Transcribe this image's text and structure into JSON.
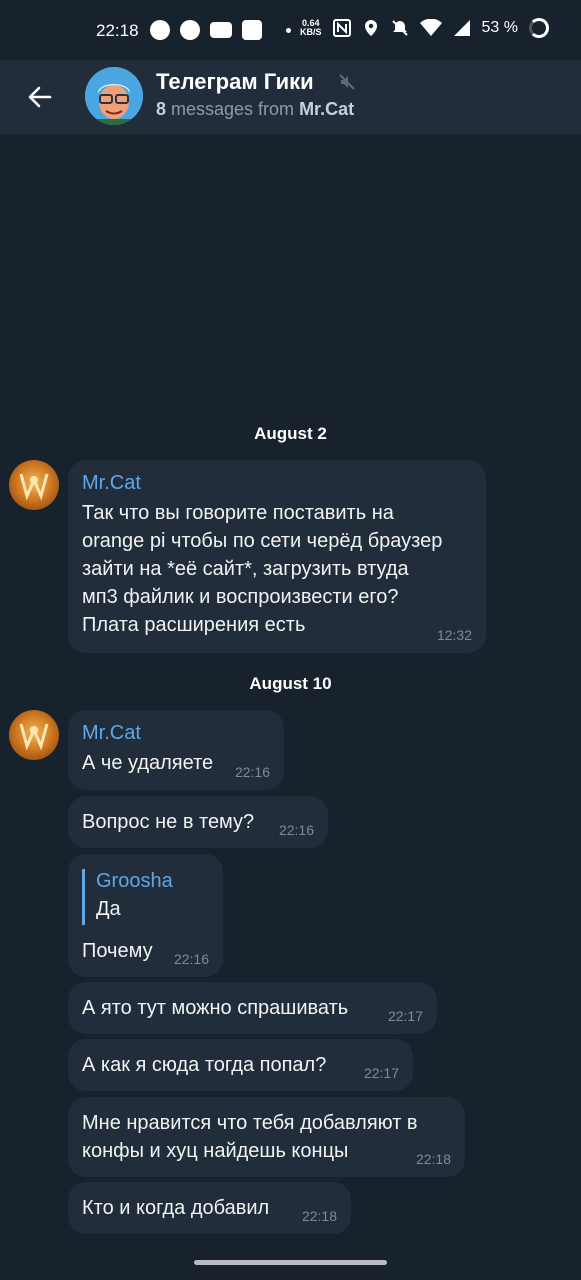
{
  "status_bar": {
    "time": "22:18",
    "speed_value": "0.64",
    "speed_unit": "KB/S",
    "battery": "53 %",
    "icons": [
      "spotify-icon",
      "telegram-icon",
      "youtube-icon",
      "instagram-icon",
      "nfc-icon",
      "location-icon",
      "mute-bell-icon",
      "wifi-icon",
      "signal-icon",
      "battery-icon"
    ]
  },
  "header": {
    "title": "Телеграм Гики",
    "count": "8",
    "subtitle_mid": " messages from ",
    "sender": "Mr.Cat"
  },
  "dates": [
    "August 2",
    "August 10"
  ],
  "messages": [
    {
      "sender": "Mr.Cat",
      "text": "Так что вы говорите поставить на\norange pi чтобы по сети черёд браузер\nзайти на *её сайт*, загрузить втуда\nмп3 файлик и воспроизвести его?\nПлата расширения есть",
      "time": "12:32"
    },
    {
      "sender": "Mr.Cat",
      "text": "А че удаляете",
      "time": "22:16"
    },
    {
      "text": "Вопрос не в тему?",
      "time": "22:16"
    },
    {
      "reply_name": "Groosha",
      "reply_text": "Да",
      "text": "Почему",
      "time": "22:16"
    },
    {
      "text": "А ято тут можно спрашивать",
      "time": "22:17"
    },
    {
      "text": "А как я сюда тогда попал?",
      "time": "22:17"
    },
    {
      "text": "Мне нравится что тебя добавляют в\nконфы и хуц найдешь концы",
      "time": "22:18"
    },
    {
      "text": "Кто и когда добавил",
      "time": "22:18"
    }
  ],
  "colors": {
    "background": "#18222d",
    "bubble": "#212d3b",
    "accent": "#5fa7e6",
    "time": "#7d8b99"
  }
}
